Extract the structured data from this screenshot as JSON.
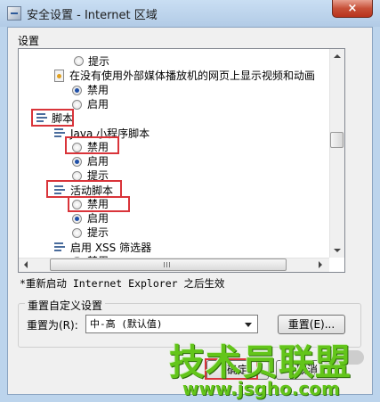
{
  "window": {
    "title": "安全设置 - Internet 区域",
    "close_glyph": "×"
  },
  "settings_group": {
    "label": "设置",
    "items": [
      {
        "kind": "radio",
        "label": "提示",
        "selected": false
      },
      {
        "kind": "option-header",
        "label": "在没有使用外部媒体播放机的网页上显示视频和动画"
      },
      {
        "kind": "radio",
        "label": "禁用",
        "selected": true
      },
      {
        "kind": "radio",
        "label": "启用",
        "selected": false
      },
      {
        "kind": "category",
        "label": "脚本"
      },
      {
        "kind": "subcategory",
        "label": "Java 小程序脚本"
      },
      {
        "kind": "radio",
        "label": "禁用",
        "selected": false
      },
      {
        "kind": "radio",
        "label": "启用",
        "selected": true
      },
      {
        "kind": "radio",
        "label": "提示",
        "selected": false
      },
      {
        "kind": "subcategory",
        "label": "活动脚本"
      },
      {
        "kind": "radio",
        "label": "禁用",
        "selected": false
      },
      {
        "kind": "radio",
        "label": "启用",
        "selected": true
      },
      {
        "kind": "radio",
        "label": "提示",
        "selected": false
      },
      {
        "kind": "subcategory",
        "label": "启用 XSS 筛选器"
      },
      {
        "kind": "radio",
        "label": "禁用",
        "selected": false
      }
    ]
  },
  "restart_note": "*重新启动 Internet Explorer 之后生效",
  "reset_group": {
    "title": "重置自定义设置",
    "reset_to_label": "重置为(R):",
    "selected_level": "中-高 (默认值)",
    "reset_button": "重置(E)..."
  },
  "footer": {
    "ok_button": "确定",
    "cancel_button": "取消"
  },
  "watermark": {
    "brand": "技术员联盟",
    "url": "www.jsgho.com"
  },
  "colors": {
    "highlight": "#d9343a",
    "watermark_green": "#63c51a",
    "radio_dot": "#1f4fa8"
  }
}
